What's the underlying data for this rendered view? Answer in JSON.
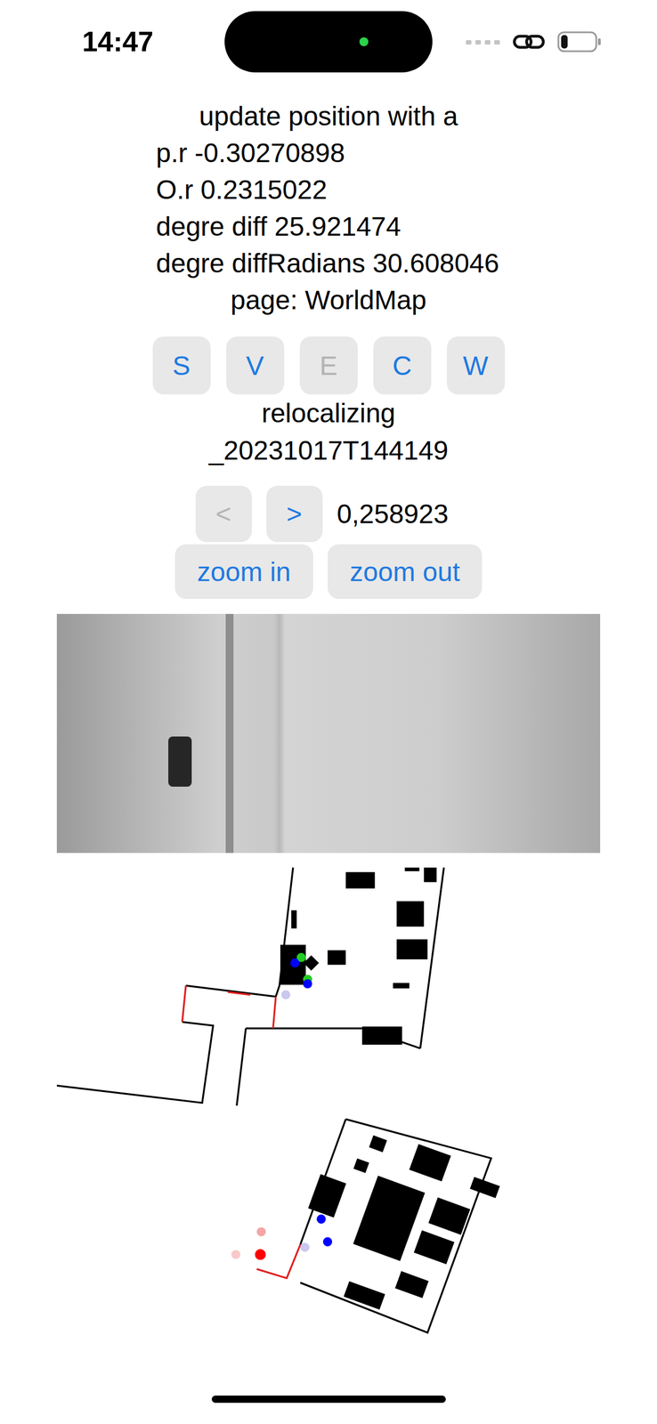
{
  "status_bar": {
    "time": "14:47",
    "battery": {
      "level": 0.2
    }
  },
  "title": "update position with a",
  "debug_lines": [
    "p.r -0.30270898",
    "O.r 0.2315022",
    "degre diff 25.921474",
    "degre diffRadians 30.608046"
  ],
  "page_label": "page: WorldMap",
  "mode_buttons": [
    {
      "label": "S",
      "disabled": false
    },
    {
      "label": "V",
      "disabled": false
    },
    {
      "label": "E",
      "disabled": true
    },
    {
      "label": "C",
      "disabled": false
    },
    {
      "label": "W",
      "disabled": false
    }
  ],
  "status": "relocalizing",
  "session": "_20231017T144149",
  "nav_buttons": [
    {
      "label": "<",
      "disabled": true
    },
    {
      "label": ">",
      "disabled": false
    }
  ],
  "nav_value": "0,258923",
  "zoom_buttons": [
    "zoom in",
    "zoom out"
  ],
  "map_markers": [
    {
      "color": "#22cc22"
    },
    {
      "color": "#0000ff"
    },
    {
      "color": "#22cc22"
    },
    {
      "color": "#0000ff"
    },
    {
      "color": "#c8c8f0"
    },
    {
      "color": "#ff0000"
    },
    {
      "color": "#f4a6a6"
    },
    {
      "color": "#f9c9c9"
    },
    {
      "color": "#0000ff"
    },
    {
      "color": "#0000ff"
    },
    {
      "color": "#c8c8f0"
    }
  ]
}
